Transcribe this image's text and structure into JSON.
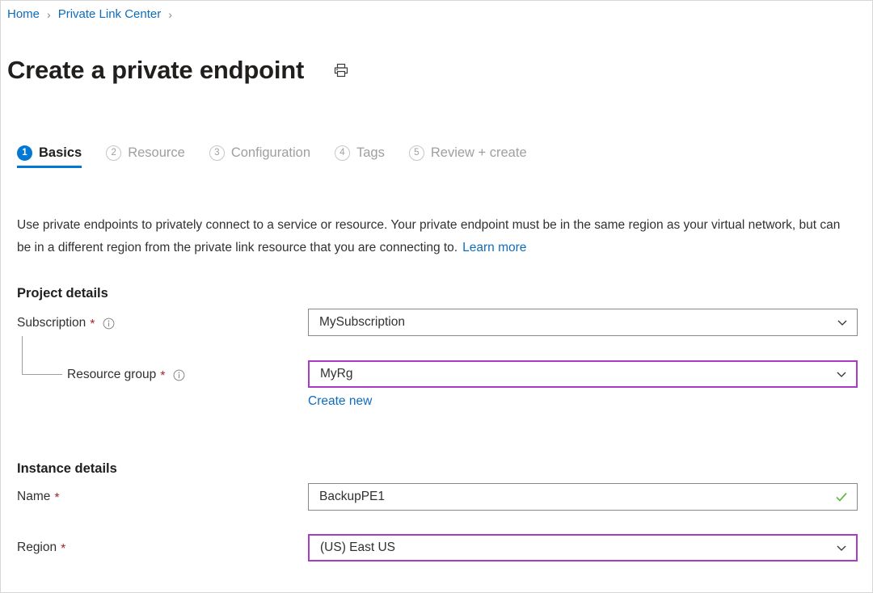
{
  "breadcrumb": {
    "items": [
      {
        "label": "Home"
      },
      {
        "label": "Private Link Center"
      }
    ],
    "separator": "›"
  },
  "header": {
    "title": "Create a private endpoint",
    "print_icon": "printer-icon"
  },
  "tabs": [
    {
      "number": "1",
      "label": "Basics",
      "active": true
    },
    {
      "number": "2",
      "label": "Resource",
      "active": false
    },
    {
      "number": "3",
      "label": "Configuration",
      "active": false
    },
    {
      "number": "4",
      "label": "Tags",
      "active": false
    },
    {
      "number": "5",
      "label": "Review + create",
      "active": false
    }
  ],
  "description": {
    "text": "Use private endpoints to privately connect to a service or resource. Your private endpoint must be in the same region as your virtual network, but can be in a different region from the private link resource that you are connecting to.",
    "link_label": "Learn more"
  },
  "project_details": {
    "heading": "Project details",
    "subscription": {
      "label": "Subscription",
      "required_marker": "*",
      "info_icon": "info-icon",
      "value": "MySubscription",
      "chevron_icon": "chevron-down-icon",
      "border_color": "#8a8886"
    },
    "resource_group": {
      "label": "Resource group",
      "required_marker": "*",
      "info_icon": "info-icon",
      "value": "MyRg",
      "chevron_icon": "chevron-down-icon",
      "create_new_label": "Create new",
      "border_color": "#a93cc4"
    }
  },
  "instance_details": {
    "heading": "Instance details",
    "name": {
      "label": "Name",
      "required_marker": "*",
      "value": "BackupPE1",
      "validation_icon": "check-icon",
      "validation_color": "#5fbb46",
      "border_color": "#8a8886"
    },
    "region": {
      "label": "Region",
      "required_marker": "*",
      "value": "(US) East US",
      "chevron_icon": "chevron-down-icon",
      "border_color": "#a93cc4"
    }
  },
  "colors": {
    "accent": "#0078d4",
    "link": "#0f6cbd",
    "required": "#a4262c",
    "focus_purple": "#a93cc4",
    "valid_green": "#5fbb46"
  }
}
